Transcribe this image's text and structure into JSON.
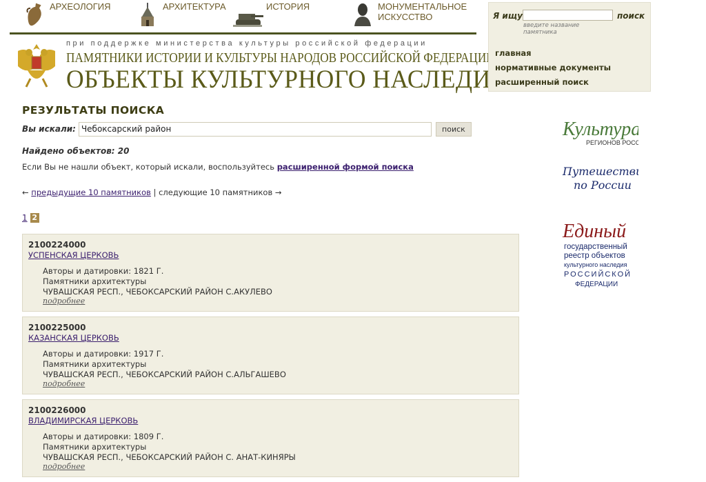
{
  "nav": {
    "categories": [
      {
        "label": "АРХЕОЛОГИЯ",
        "icon": "amphora-icon"
      },
      {
        "label": "АРХИТЕКТУРА",
        "icon": "church-icon"
      },
      {
        "label": "ИСТОРИЯ",
        "icon": "tank-icon"
      },
      {
        "label": "МОНУМЕНТАЛЬНОЕ ИСКУССТВО",
        "icon": "bust-icon"
      }
    ]
  },
  "header": {
    "support": "при поддержке министерства культуры российской федерации",
    "monuments": "ПАМЯТНИКИ ИСТОРИИ И КУЛЬТУРЫ НАРОДОВ РОССИЙСКОЙ ФЕДЕРАЦИИ",
    "title": "ОБЪЕКТЫ КУЛЬТУРНОГО НАСЛЕДИЯ"
  },
  "sidebar": {
    "search_label": "Я ищу",
    "search_value": "",
    "search_hint": "введите название памятника",
    "search_button": "поиск",
    "links": [
      "главная",
      "нормативные документы",
      "расширенный поиск"
    ]
  },
  "main": {
    "title": "РЕЗУЛЬТАТЫ ПОИСКА",
    "query_label": "Вы искали:",
    "query_value": "Чебоксарский район",
    "query_button": "поиск",
    "found": "Найдено объектов: 20",
    "hint_text": "Если Вы не нашли объект, который искали, воспользуйтесь",
    "hint_link": "расширенной формой поиска",
    "prev_arrow": "←",
    "prev": "предыдущие 10 памятников",
    "separator": "|",
    "next": "следующие 10 памятников",
    "next_arrow": "→",
    "pages": [
      "1",
      "2"
    ],
    "current_page": "2"
  },
  "results": [
    {
      "number": "2100224000",
      "name": "УСПЕНСКАЯ ЦЕРКОВЬ",
      "authors": "Авторы и датировки: 1821 Г.",
      "type": "Памятники архитектуры",
      "address": "ЧУВАШСКАЯ РЕСП., ЧЕБОКСАРСКИЙ РАЙОН С.АКУЛЕВО",
      "more": "подробнее"
    },
    {
      "number": "2100225000",
      "name": "КАЗАНСКАЯ ЦЕРКОВЬ",
      "authors": "Авторы и датировки: 1917 Г.",
      "type": "Памятники архитектуры",
      "address": "ЧУВАШСКАЯ РЕСП., ЧЕБОКСАРСКИЙ РАЙОН С.АЛЬГАШЕВО",
      "more": "подробнее"
    },
    {
      "number": "2100226000",
      "name": "ВЛАДИМИРСКАЯ ЦЕРКОВЬ",
      "authors": "Авторы и датировки: 1809 Г.",
      "type": "Памятники архитектуры",
      "address": "ЧУВАШСКАЯ РЕСП., ЧЕБОКСАРСКИЙ РАЙОН С. АНАТ-КИНЯРЫ",
      "more": "подробнее"
    }
  ],
  "banners": {
    "kultura_main": "Культура",
    "kultura_sub": "РЕГИОНОВ РОССИИ",
    "travel_1": "Путешествие",
    "travel_2": "по России",
    "registry_main": "Единый",
    "registry_l1": "государственный",
    "registry_l2": "реестр объектов",
    "registry_l3": "культурного наследия",
    "registry_l4": "РОССИЙСКОЙ",
    "registry_l5": "ФЕДЕРАЦИИ"
  },
  "colors": {
    "olive": "#5b5b1a",
    "panel": "#f1efe2",
    "link": "#3b1f6e",
    "registry_red": "#8b1a1a",
    "registry_blue": "#1a2a6b",
    "kultura_green": "#4a7a3a"
  }
}
